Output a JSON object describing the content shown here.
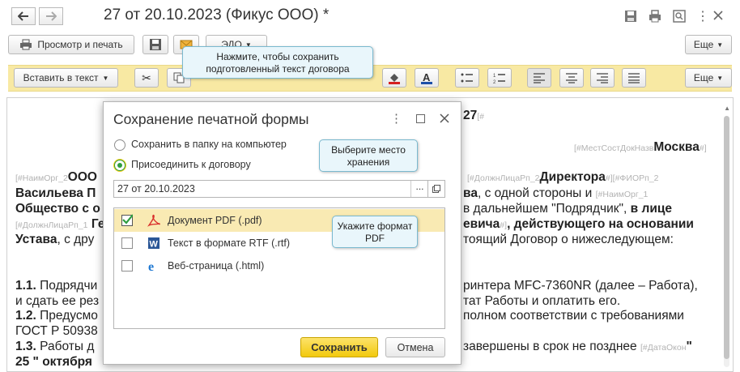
{
  "window": {
    "title": "27 от 20.10.2023 (Фикус ООО) *"
  },
  "toolbar": {
    "print_preview_label": "Просмотр и печать",
    "edo_label": "ЭДО",
    "more_label": "Еще"
  },
  "format_bar": {
    "insert_label": "Вставить в текст",
    "more_label": "Еще"
  },
  "callouts": {
    "save_hint": "Нажмите, чтобы сохранить подготовленный текст договора",
    "location_hint": "Выберите место хранения",
    "format_hint": "Укажите формат PDF"
  },
  "document": {
    "num": "27",
    "num_field": "[#",
    "city_field": "[#МестСостДокНазв",
    "city": "Москва",
    "city_field_end": "#]",
    "org_field": "[#НаимОрг_2",
    "org_start": "ООО",
    "pos_field": "[#ДолжнЛицаРп_2",
    "director": "Директора",
    "field_end": "#]",
    "fio_field": "[#ФИОРп_2",
    "line2_left": "Васильева П",
    "line2_right_bold": "ва",
    "line2_right": ", с одной стороны и",
    "org1_field": "[#НаимОрг_1",
    "line3_left": "Общество с о",
    "line3_right": "в дальнейшем \"Подрядчик\",",
    "line3_right_bold": " в лице",
    "pos1_field": "[#ДолжнЛицаРп_1",
    "line4_left": "Ге",
    "line4_right_bold": "евича",
    "line4_right": ", действующего на основании",
    "line5_left_bold": "Устава",
    "line5_left": ", с дру",
    "line5_right": "тоящий Договор о нижеследующем:",
    "p11_num": "1.1.",
    "p11_left": " Подрядчи",
    "p11_right": "ринтера MFC-7360NR (далее – Работа),",
    "p11b_left": "и сдать ее рез",
    "p11b_right": "тат Работы и оплатить его.",
    "p12_num": "1.2.",
    "p12_left": " Предусмо",
    "p12_right": "полном соответствии с требованиями",
    "p12b_left": "ГОСТ Р 50938",
    "p13_num": "1.3.",
    "p13_left": " Работы д",
    "p13_right": "завершены в срок не позднее",
    "date_field": "[#ДатаОкон",
    "p13_quote": "\"",
    "p13b_left": "25 \" октября"
  },
  "dialog": {
    "title": "Сохранение печатной формы",
    "option_save_to_folder": "Сохранить в папку на компьютер",
    "option_attach": "Присоединить к договору",
    "attach_value": "27 от 20.10.2023",
    "formats": [
      {
        "label": "Документ PDF (.pdf)",
        "checked": true
      },
      {
        "label": "Текст в формате RTF (.rtf)",
        "checked": false
      },
      {
        "label": "Веб-страница (.html)",
        "checked": false
      }
    ],
    "save_button": "Сохранить",
    "cancel_button": "Отмена",
    "browse_label": "..."
  },
  "colors": {
    "accent_yellow": "#f7d21b",
    "format_bar": "#f8e9a3",
    "callout_bg": "#e9f6fb",
    "pdf_red": "#d9302c",
    "word_blue": "#2b5797",
    "radio_green": "#2e9d3f"
  }
}
